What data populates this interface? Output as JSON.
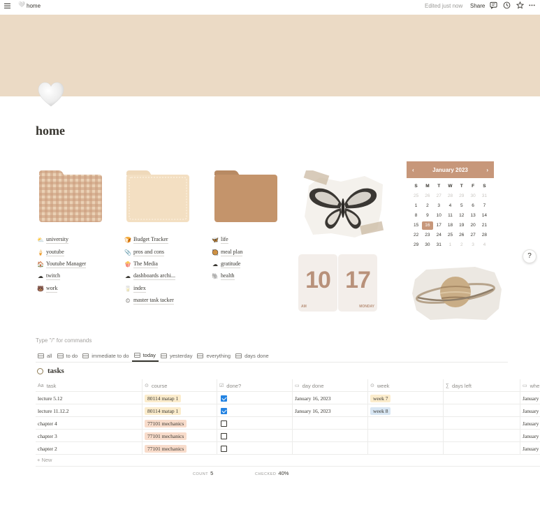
{
  "topbar": {
    "breadcrumb": "home",
    "edited": "Edited just now",
    "share": "Share"
  },
  "page": {
    "title": "home"
  },
  "links": {
    "col1": [
      {
        "emoji": "⛅",
        "label": "university"
      },
      {
        "emoji": "🍦",
        "label": "youtube"
      },
      {
        "emoji": "🏠",
        "label": "Youtube Manager"
      },
      {
        "emoji": "☁",
        "label": "twitch"
      },
      {
        "emoji": "🐻",
        "label": "work"
      }
    ],
    "col2": [
      {
        "emoji": "🍞",
        "label": "Budget Tracker"
      },
      {
        "emoji": "📎",
        "label": "pros and cons"
      },
      {
        "emoji": "🍿",
        "label": "The Media"
      },
      {
        "emoji": "☁",
        "label": "dashboards archi..."
      },
      {
        "emoji": "🥛",
        "label": "index"
      },
      {
        "emoji": "⏲",
        "label": "master task tacker"
      }
    ],
    "col3": [
      {
        "emoji": "🦋",
        "label": "life"
      },
      {
        "emoji": "🥘",
        "label": "meal plan"
      },
      {
        "emoji": "☁",
        "label": "gratitude"
      },
      {
        "emoji": "🐘",
        "label": "health"
      }
    ]
  },
  "clock": {
    "hour": "10",
    "minute": "17",
    "ampm": "AM",
    "day": "MONDAY"
  },
  "calendar": {
    "month": "January 2023",
    "prev": "‹",
    "next": "›",
    "weekdays": [
      "S",
      "M",
      "T",
      "W",
      "T",
      "F",
      "S"
    ],
    "days": [
      {
        "d": "25",
        "dim": true
      },
      {
        "d": "26",
        "dim": true
      },
      {
        "d": "27",
        "dim": true
      },
      {
        "d": "28",
        "dim": true
      },
      {
        "d": "29",
        "dim": true
      },
      {
        "d": "30",
        "dim": true
      },
      {
        "d": "31",
        "dim": true
      },
      {
        "d": "1"
      },
      {
        "d": "2"
      },
      {
        "d": "3"
      },
      {
        "d": "4"
      },
      {
        "d": "5"
      },
      {
        "d": "6"
      },
      {
        "d": "7"
      },
      {
        "d": "8"
      },
      {
        "d": "9"
      },
      {
        "d": "10"
      },
      {
        "d": "11"
      },
      {
        "d": "12"
      },
      {
        "d": "13"
      },
      {
        "d": "14"
      },
      {
        "d": "15"
      },
      {
        "d": "16",
        "today": true
      },
      {
        "d": "17"
      },
      {
        "d": "18"
      },
      {
        "d": "19"
      },
      {
        "d": "20"
      },
      {
        "d": "21"
      },
      {
        "d": "22"
      },
      {
        "d": "23"
      },
      {
        "d": "24"
      },
      {
        "d": "25"
      },
      {
        "d": "26"
      },
      {
        "d": "27"
      },
      {
        "d": "28"
      },
      {
        "d": "29"
      },
      {
        "d": "30"
      },
      {
        "d": "31"
      },
      {
        "d": "1",
        "dim": true
      },
      {
        "d": "2",
        "dim": true
      },
      {
        "d": "3",
        "dim": true
      },
      {
        "d": "4",
        "dim": true
      }
    ]
  },
  "help": "?",
  "editor": {
    "placeholder": "Type \"/\" for commands"
  },
  "views": [
    {
      "label": "all"
    },
    {
      "label": "to do"
    },
    {
      "label": "immediate to do"
    },
    {
      "label": "today",
      "active": true
    },
    {
      "label": "yesterday"
    },
    {
      "label": "everything"
    },
    {
      "label": "days done"
    }
  ],
  "database": {
    "title": "tasks",
    "columns": [
      {
        "icon": "Aa",
        "label": "task"
      },
      {
        "icon": "⊙",
        "label": "course"
      },
      {
        "icon": "☑",
        "label": "done?"
      },
      {
        "icon": "▭",
        "label": "day done"
      },
      {
        "icon": "⊙",
        "label": "week"
      },
      {
        "icon": "∑",
        "label": "days left"
      },
      {
        "icon": "▭",
        "label": "whe"
      }
    ],
    "rows": [
      {
        "task": "lecture 5.12",
        "course": "80114 matap 1",
        "course_color": "#fbeccc",
        "done": true,
        "day_done": "January 16, 2023",
        "week": "week 7",
        "week_color": "#fbeccc",
        "when": "January"
      },
      {
        "task": "lecture 11.12.2",
        "course": "80114 matap 1",
        "course_color": "#fbeccc",
        "done": true,
        "day_done": "January 16, 2023",
        "week": "week 8",
        "week_color": "#d8e6f3",
        "when": "January"
      },
      {
        "task": "chapter 4",
        "course": "77101 mechanics",
        "course_color": "#f8dccb",
        "done": false,
        "day_done": "",
        "week": "",
        "week_color": "",
        "when": "January"
      },
      {
        "task": "chapter 3",
        "course": "77101 mechanics",
        "course_color": "#f8dccb",
        "done": false,
        "day_done": "",
        "week": "",
        "week_color": "",
        "when": "January"
      },
      {
        "task": "chapter 2",
        "course": "77101 mechanics",
        "course_color": "#f8dccb",
        "done": false,
        "day_done": "",
        "week": "",
        "week_color": "",
        "when": "January"
      }
    ],
    "new_label": "+ New",
    "footer": {
      "count_label": "COUNT",
      "count": "5",
      "checked_label": "CHECKED",
      "checked": "40%"
    }
  }
}
